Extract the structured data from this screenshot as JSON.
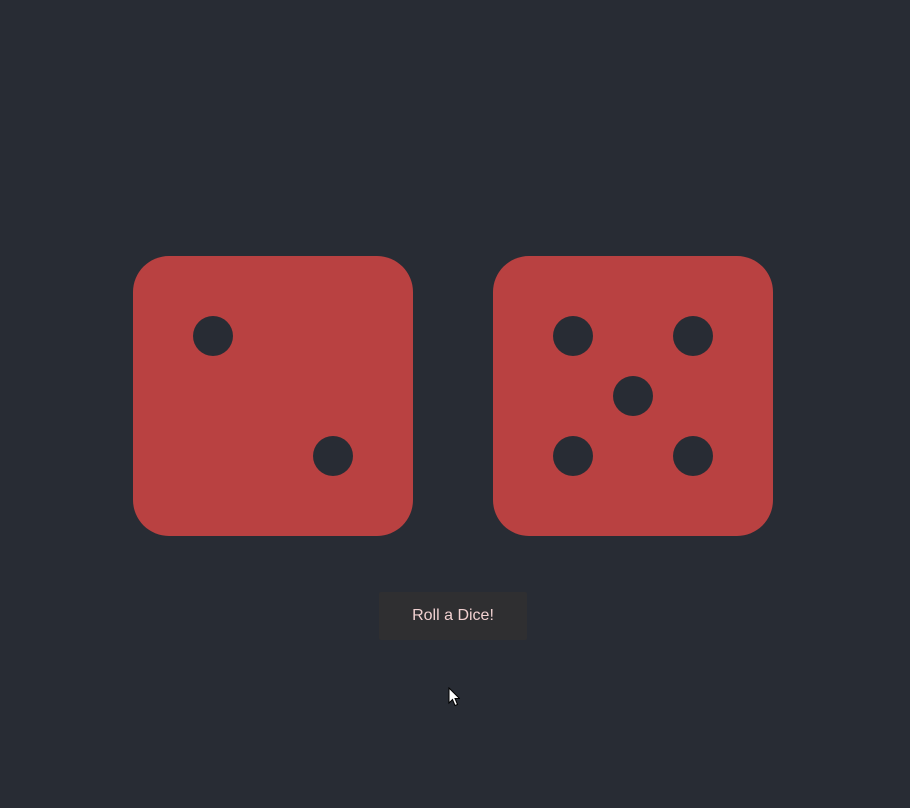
{
  "dice": [
    {
      "name": "die-one",
      "value": 2
    },
    {
      "name": "die-two",
      "value": 5
    }
  ],
  "button": {
    "label": "Roll a Dice!"
  },
  "cursor": {
    "icon": "mouse-pointer-icon"
  },
  "colors": {
    "background": "#282c34",
    "die": "#b94141",
    "pip": "#282c34",
    "button_bg": "#2f2f31",
    "button_text": "#f0d0d0"
  }
}
